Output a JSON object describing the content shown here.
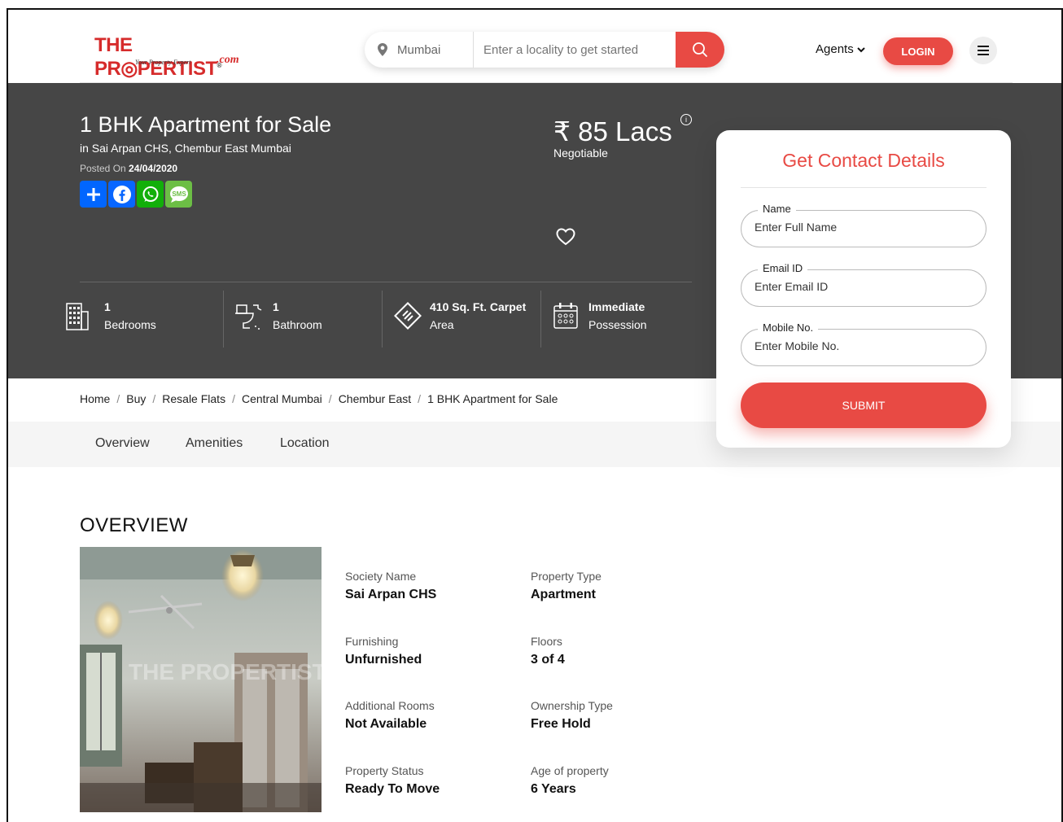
{
  "header": {
    "logo_text_1": "THE PR",
    "logo_text_2": "PERTIST",
    "logo_reg": "®",
    "logo_tagline": "Your Property Expert",
    "logo_com": ".com",
    "city": "Mumbai",
    "search_placeholder": "Enter a locality to get started",
    "agents_label": "Agents",
    "login_label": "LOGIN"
  },
  "hero": {
    "title": "1 BHK Apartment for Sale",
    "subtitle": "in Sai Arpan CHS, Chembur East Mumbai",
    "posted_prefix": "Posted On ",
    "posted_date": "24/04/2020",
    "price": "₹ 85 Lacs",
    "price_info": "i",
    "negotiable": "Negotiable",
    "specs": [
      {
        "value": "1",
        "label": "Bedrooms"
      },
      {
        "value": "1",
        "label": "Bathroom"
      },
      {
        "value": "410 Sq. Ft. Carpet",
        "label": "Area"
      },
      {
        "value": "Immediate",
        "label": "Possession"
      }
    ]
  },
  "contact": {
    "title": "Get Contact Details",
    "fields": [
      {
        "label": "Name",
        "placeholder": "Enter Full Name"
      },
      {
        "label": "Email ID",
        "placeholder": "Enter Email ID"
      },
      {
        "label": "Mobile No.",
        "placeholder": "Enter Mobile No."
      }
    ],
    "submit": "SUBMIT"
  },
  "breadcrumb": [
    "Home",
    "Buy",
    "Resale Flats",
    "Central Mumbai",
    "Chembur East",
    "1 BHK Apartment for Sale"
  ],
  "tabs": [
    "Overview",
    "Amenities",
    "Location"
  ],
  "overview": {
    "title": "OVERVIEW",
    "watermark": "THE PROPERTIST",
    "details": [
      {
        "key": "Society Name",
        "value": "Sai Arpan CHS"
      },
      {
        "key": "Property Type",
        "value": "Apartment"
      },
      {
        "key": "Furnishing",
        "value": "Unfurnished"
      },
      {
        "key": "Floors",
        "value": "3 of 4"
      },
      {
        "key": "Additional Rooms",
        "value": "Not Available"
      },
      {
        "key": "Ownership Type",
        "value": "Free Hold"
      },
      {
        "key": "Property Status",
        "value": "Ready To Move"
      },
      {
        "key": "Age of property",
        "value": "6 Years"
      }
    ]
  },
  "colors": {
    "accent": "#e84a44",
    "hero_bg": "#464646"
  }
}
